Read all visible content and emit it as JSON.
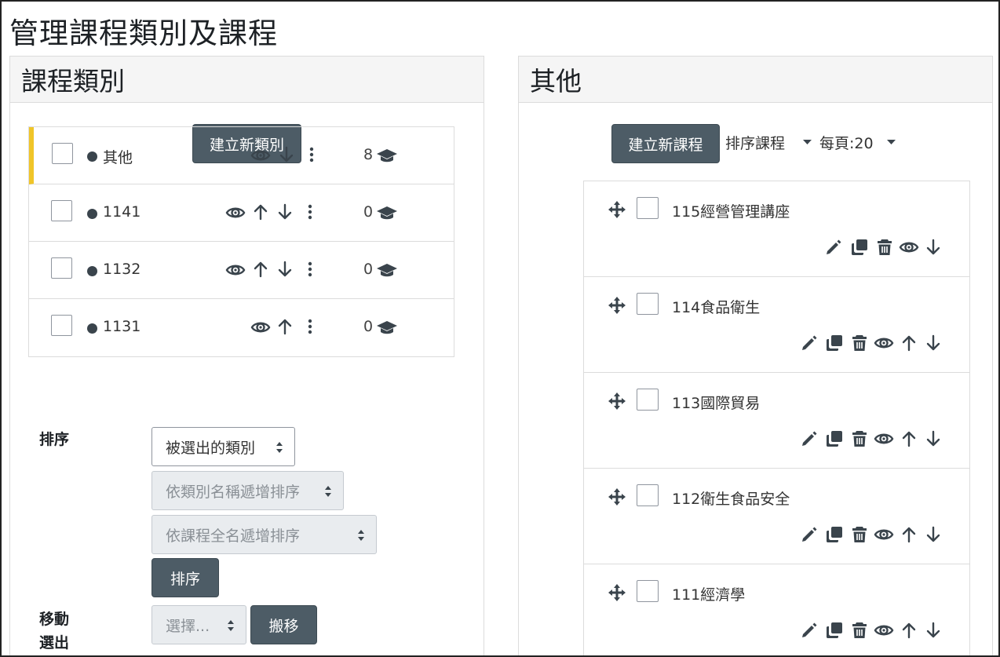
{
  "page": {
    "title": "管理課程類別及課程"
  },
  "categories_panel": {
    "heading": "課程類別",
    "create_button": "建立新類別",
    "items": [
      {
        "name": "其他",
        "count": "8",
        "active": true,
        "actions": [
          "eye-icon",
          "arrow-down-icon",
          "more-icon"
        ]
      },
      {
        "name": "1141",
        "count": "0",
        "active": false,
        "actions": [
          "eye-icon",
          "arrow-up-icon",
          "arrow-down-icon",
          "more-icon"
        ]
      },
      {
        "name": "1132",
        "count": "0",
        "active": false,
        "actions": [
          "eye-icon",
          "arrow-up-icon",
          "arrow-down-icon",
          "more-icon"
        ]
      },
      {
        "name": "1131",
        "count": "0",
        "active": false,
        "actions": [
          "eye-icon",
          "arrow-up-icon",
          "more-icon"
        ]
      }
    ],
    "sort": {
      "label": "排序",
      "select_scope": "被選出的類別",
      "select_category_sort": "依類別名稱遞增排序",
      "select_course_sort": "依課程全名遞增排序",
      "button": "排序"
    },
    "move": {
      "label_line1": "移動",
      "label_line2": "選出",
      "select": "選擇...",
      "button": "搬移"
    }
  },
  "courses_panel": {
    "heading": "其他",
    "create_button": "建立新課程",
    "sort_label": "排序課程",
    "per_page_label": "每頁:20",
    "courses": [
      {
        "name": "115經營管理講座",
        "actions": [
          "edit-icon",
          "copy-icon",
          "delete-icon",
          "eye-icon",
          "arrow-down-icon"
        ]
      },
      {
        "name": "114食品衛生",
        "actions": [
          "edit-icon",
          "copy-icon",
          "delete-icon",
          "eye-icon",
          "arrow-up-icon",
          "arrow-down-icon"
        ]
      },
      {
        "name": "113國際貿易",
        "actions": [
          "edit-icon",
          "copy-icon",
          "delete-icon",
          "eye-icon",
          "arrow-up-icon",
          "arrow-down-icon"
        ]
      },
      {
        "name": "112衛生食品安全",
        "actions": [
          "edit-icon",
          "copy-icon",
          "delete-icon",
          "eye-icon",
          "arrow-up-icon",
          "arrow-down-icon"
        ]
      },
      {
        "name": "111經濟學",
        "actions": [
          "edit-icon",
          "copy-icon",
          "delete-icon",
          "eye-icon",
          "arrow-up-icon",
          "arrow-down-icon"
        ]
      }
    ]
  },
  "colors": {
    "button_bg": "#4d5c66",
    "active_marker": "#f0c528",
    "icon": "#3a444c"
  }
}
